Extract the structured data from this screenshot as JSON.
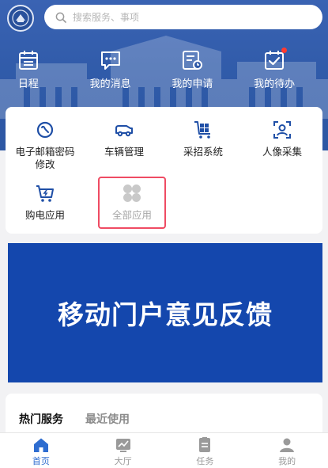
{
  "search": {
    "placeholder": "搜索服务、事项"
  },
  "quick_actions": [
    {
      "label": "日程",
      "icon": "calendar-icon"
    },
    {
      "label": "我的消息",
      "icon": "message-icon"
    },
    {
      "label": "我的申请",
      "icon": "application-icon"
    },
    {
      "label": "我的待办",
      "icon": "todo-icon",
      "has_badge": true
    }
  ],
  "apps": [
    {
      "label": "电子邮箱密码修改",
      "icon": "email-password-icon"
    },
    {
      "label": "车辆管理",
      "icon": "vehicle-icon"
    },
    {
      "label": "采招系统",
      "icon": "procurement-cart-icon"
    },
    {
      "label": "人像采集",
      "icon": "portrait-scan-icon"
    },
    {
      "label": "购电应用",
      "icon": "power-purchase-cart-icon"
    },
    {
      "label": "全部应用",
      "icon": "all-apps-icon"
    }
  ],
  "banner": {
    "text": "移动门户意见反馈"
  },
  "hot": {
    "tab_hot": "热门服务",
    "tab_recent": "最近使用"
  },
  "nav": [
    {
      "label": "首页",
      "icon": "home-icon",
      "active": true
    },
    {
      "label": "大厅",
      "icon": "hall-icon"
    },
    {
      "label": "任务",
      "icon": "task-icon"
    },
    {
      "label": "我的",
      "icon": "profile-icon"
    }
  ],
  "colors": {
    "header": "#2f5aa8",
    "accent": "#2e6dd0",
    "banner": "#1447ad",
    "highlight": "#ef4b63",
    "badge": "#ff3b30"
  }
}
